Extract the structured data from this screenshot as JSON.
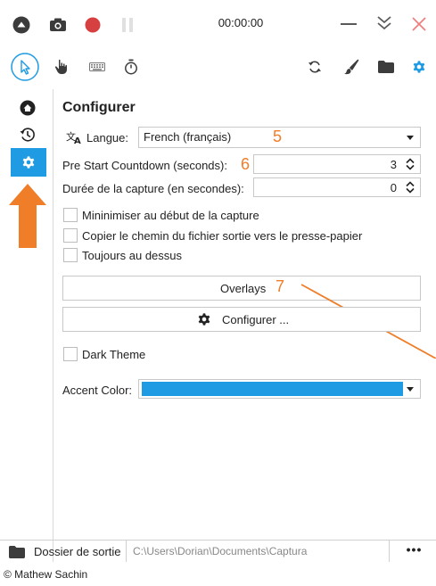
{
  "titlebar": {
    "timer": "00:00:00"
  },
  "toolbar": {
    "icons": [
      "cursor-icon",
      "hand-icon",
      "keyboard-icon",
      "stopwatch-icon",
      "refresh-icon",
      "brush-icon",
      "folder-icon",
      "gear-icon"
    ]
  },
  "sidebar": {
    "items": [
      "home-icon",
      "history-icon",
      "gear-icon"
    ],
    "selected": "gear-icon"
  },
  "page": {
    "title": "Configurer",
    "language_label": "Langue:",
    "language_value": "French (français)",
    "countdown_label": "Pre Start Countdown (seconds):",
    "countdown_value": "3",
    "duration_label": "Durée de la capture (en secondes):",
    "duration_value": "0",
    "checkboxes": [
      {
        "label": "Mininimiser au début de la capture",
        "checked": false
      },
      {
        "label": "Copier le chemin du fichier sortie vers le presse-papier",
        "checked": false
      },
      {
        "label": "Toujours au dessus",
        "checked": false
      }
    ],
    "overlays_label": "Overlays",
    "configure_label": "Configurer ...",
    "dark_theme_label": "Dark Theme",
    "dark_theme_checked": false,
    "accent_label": "Accent Color:",
    "accent_color": "#1e9be2"
  },
  "annotations": {
    "n5": "5",
    "n6": "6",
    "n7": "7",
    "color": "#f07d28"
  },
  "bottom": {
    "output_label": "Dossier de sortie",
    "output_path": "C:\\Users\\Dorian\\Documents\\Captura",
    "more_label": "•••",
    "copyright": "© Mathew Sachin"
  }
}
